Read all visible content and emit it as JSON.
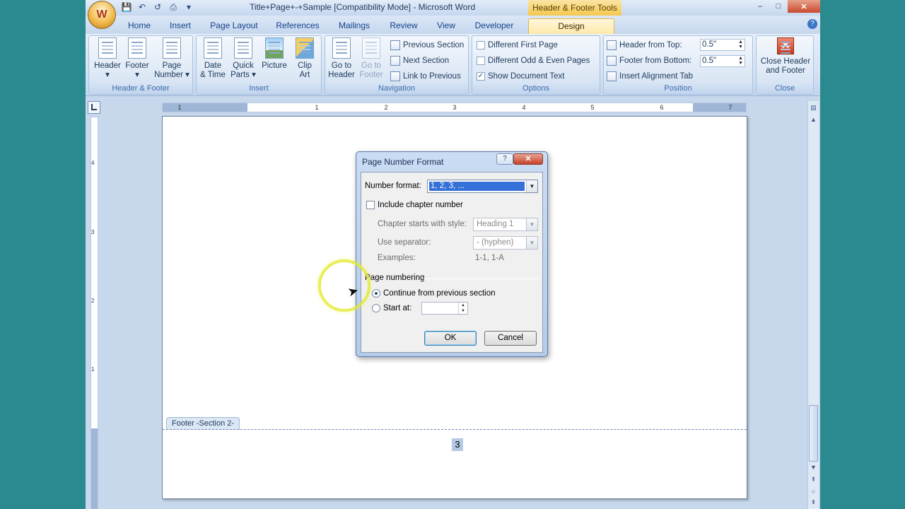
{
  "window": {
    "title": "Title+Page+-+Sample [Compatibility Mode] - Microsoft Word",
    "contextual_tab_group": "Header & Footer Tools",
    "office_button_glyph": "W",
    "controls": {
      "minimize": "–",
      "maximize": "□",
      "close": "✕"
    }
  },
  "quick_access": [
    {
      "name": "save-icon",
      "glyph": "💾"
    },
    {
      "name": "undo-icon",
      "glyph": "↶"
    },
    {
      "name": "redo-icon",
      "glyph": "↺"
    },
    {
      "name": "print-icon",
      "glyph": "⎙"
    },
    {
      "name": "customize-qat-icon",
      "glyph": "▾"
    }
  ],
  "tabs": [
    "Home",
    "Insert",
    "Page Layout",
    "References",
    "Mailings",
    "Review",
    "View",
    "Developer",
    "Design"
  ],
  "active_tab": "Design",
  "ribbon": {
    "header_footer_group": {
      "label": "Header & Footer",
      "header": [
        "Header",
        "▾"
      ],
      "footer": [
        "Footer",
        "▾"
      ],
      "page_number": [
        "Page",
        "Number ▾"
      ]
    },
    "insert_group": {
      "label": "Insert",
      "date_time": [
        "Date",
        "& Time"
      ],
      "quick_parts": [
        "Quick",
        "Parts ▾"
      ],
      "picture": [
        "Picture",
        ""
      ],
      "clip_art": [
        "Clip",
        "Art"
      ]
    },
    "navigation_group": {
      "label": "Navigation",
      "go_to_header": [
        "Go to",
        "Header"
      ],
      "go_to_footer": [
        "Go to",
        "Footer"
      ],
      "previous_section": "Previous Section",
      "next_section": "Next Section",
      "link_to_previous": "Link to Previous"
    },
    "options_group": {
      "label": "Options",
      "different_first_page": "Different First Page",
      "different_odd_even": "Different Odd & Even Pages",
      "show_document_text": "Show Document Text",
      "show_document_text_checked": true
    },
    "position_group": {
      "label": "Position",
      "header_from_top_label": "Header from Top:",
      "header_from_top_value": "0.5\"",
      "footer_from_bottom_label": "Footer from Bottom:",
      "footer_from_bottom_value": "0.5\"",
      "insert_alignment_tab": "Insert Alignment Tab"
    },
    "close_group": {
      "label": "Close",
      "close_header_footer": [
        "Close Header",
        "and Footer"
      ]
    }
  },
  "ruler": {
    "ticks": [
      "1",
      "1",
      "2",
      "3",
      "4",
      "5",
      "6",
      "7"
    ]
  },
  "vruler": {
    "ticks": [
      "4",
      "3",
      "2",
      "1"
    ]
  },
  "document": {
    "footer_tag": "Footer -Section 2-",
    "page_number": "3"
  },
  "dialog": {
    "title": "Page Number Format",
    "help": "?",
    "close": "✕",
    "number_format_label": "Number format:",
    "number_format_value": "1, 2, 3, ...",
    "include_chapter_number": "Include chapter number",
    "chapter_starts_label": "Chapter starts with style:",
    "chapter_starts_value": "Heading 1",
    "separator_label": "Use separator:",
    "separator_value": "-  (hyphen)",
    "examples_label": "Examples:",
    "examples_value": "1-1, 1-A",
    "page_numbering_label": "Page numbering",
    "continue_option": "Continue from previous section",
    "start_at_option": "Start at:",
    "start_at_value": "",
    "selected_option": "continue",
    "ok": "OK",
    "cancel": "Cancel"
  },
  "colors": {
    "desktop": "#2b8a8f",
    "accent": "#3470d8",
    "contextual": "#f4c84e"
  }
}
